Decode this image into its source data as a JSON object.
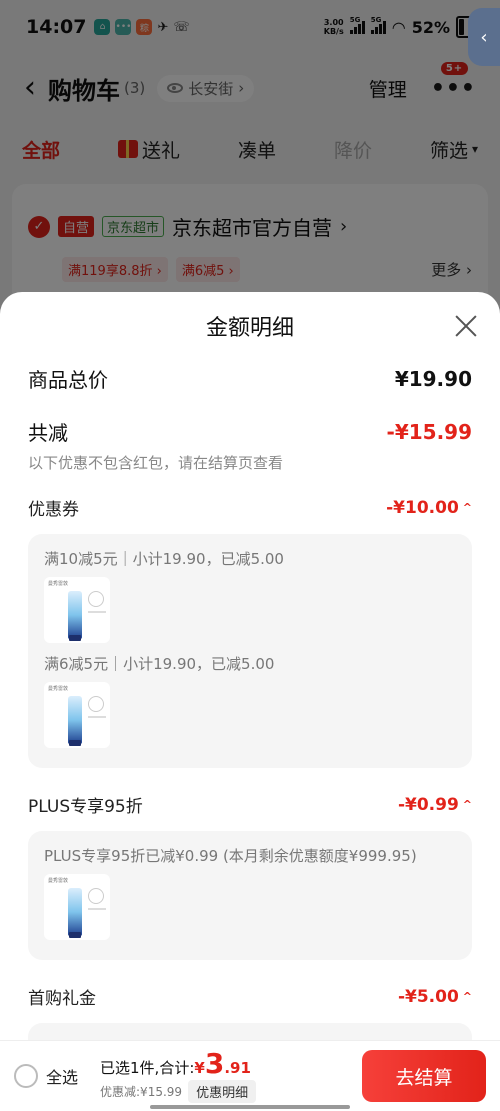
{
  "status_bar": {
    "time": "14:07",
    "app_chips": [
      {
        "glyph": "⌂",
        "color": "#26a69a"
      },
      {
        "glyph": "•••",
        "color": "#4db6ac"
      },
      {
        "glyph": "粽",
        "color": "#ff6f3c"
      }
    ],
    "net_speed_value": "3.00",
    "net_speed_unit": "KB/s",
    "signal_tag_1": "5G",
    "signal_tag_2": "5G",
    "battery": "52%"
  },
  "cart_header": {
    "title": "购物车",
    "count": "(3)",
    "location": "长安街",
    "location_chevron": "›",
    "manage": "管理",
    "more_dots": "•••",
    "badge": "5+"
  },
  "tabs": [
    {
      "label": "全部"
    },
    {
      "label": "送礼"
    },
    {
      "label": "凑单"
    },
    {
      "label": "降价"
    },
    {
      "label": "筛选"
    }
  ],
  "store": {
    "self_tag": "自营",
    "market_tag": "京东超市",
    "name": "京东超市官方自营",
    "name_chevron": "›",
    "promos": [
      "满119享8.8折 ›",
      "满6减5 ›"
    ],
    "more": "更多 ›"
  },
  "sheet": {
    "title": "金额明细",
    "total_label": "商品总价",
    "total_value": "¥19.90",
    "reduce_label": "共减",
    "reduce_value": "-¥15.99",
    "reduce_note": "以下优惠不包含红包，请在结算页查看",
    "coupon_label": "优惠券",
    "coupon_value": "-¥10.00",
    "coupon_detail_1": "满10减5元｜小计19.90，已减5.00",
    "coupon_detail_2": "满6减5元｜小计19.90，已减5.00",
    "plus_label": "PLUS专享95折",
    "plus_value": "-¥0.99",
    "plus_detail": "PLUS专享95折已减¥0.99 (本月剩余优惠额度¥999.95)",
    "first_label": "首购礼金",
    "first_value": "-¥5.00",
    "product_brand": "曼秀雷敦",
    "caret": "^"
  },
  "bottom_bar": {
    "select_all": "全选",
    "selected_total": "已选1件,合计:",
    "currency": "¥",
    "price_int": "3",
    "price_dec": ".91",
    "discount_note": "优惠减:¥15.99",
    "detail_button": "优惠明细",
    "checkout": "去结算"
  }
}
